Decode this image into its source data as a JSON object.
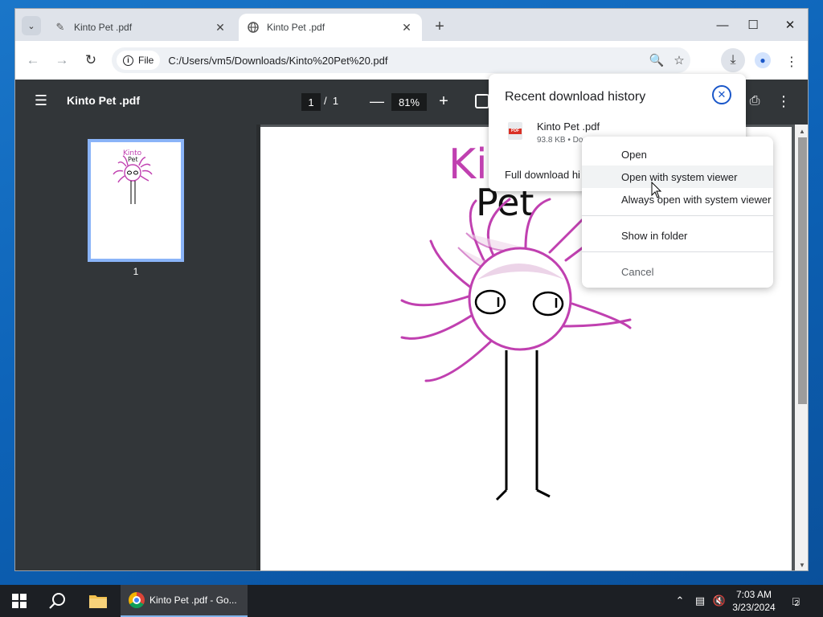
{
  "tabs": [
    {
      "title": "Kinto Pet .pdf",
      "icon": "pencil-icon"
    },
    {
      "title": "Kinto Pet .pdf",
      "icon": "globe-icon",
      "active": true
    }
  ],
  "toolbar": {
    "file_chip": "File",
    "url": "C:/Users/vm5/Downloads/Kinto%20Pet%20.pdf"
  },
  "pdf": {
    "title": "Kinto Pet .pdf",
    "page_current": "1",
    "page_separator": "/",
    "page_total": "1",
    "zoom": "81%",
    "thumbnail_label": "1",
    "drawing_text_top": "Kinto",
    "drawing_text_bottom": "Pet",
    "accent_color": "#c040b0"
  },
  "download_bubble": {
    "heading": "Recent download history",
    "item_name": "Kinto Pet .pdf",
    "item_meta": "93.8 KB • Do",
    "file_badge": "PDF",
    "full_history": "Full download hi"
  },
  "context_menu": {
    "items": [
      {
        "label": "Open"
      },
      {
        "label": "Open with system viewer",
        "hovered": true
      },
      {
        "label": "Always open with system viewer"
      },
      {
        "label": "Show in folder"
      },
      {
        "label": "Cancel"
      }
    ]
  },
  "taskbar": {
    "app_label": "Kinto Pet .pdf - Go...",
    "time": "7:03 AM",
    "date": "3/23/2024",
    "notification_count": "2"
  }
}
